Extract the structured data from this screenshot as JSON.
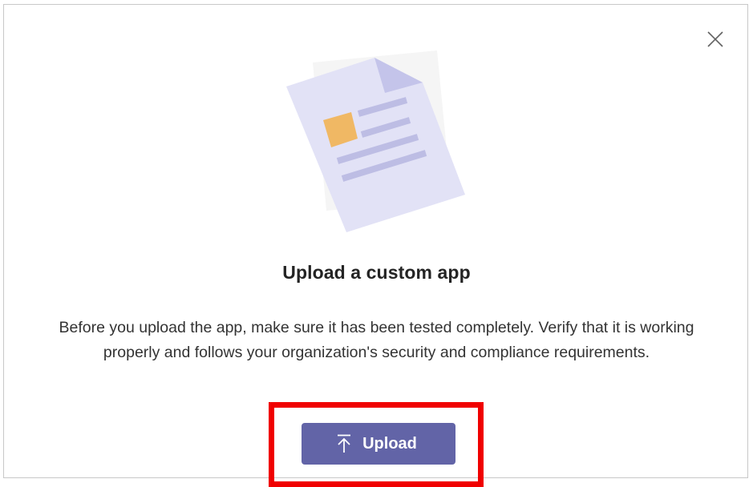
{
  "dialog": {
    "title": "Upload a custom app",
    "description": "Before you upload the app, make sure it has been tested completely. Verify that it is working properly and follows your organization's security and compliance requirements.",
    "upload_button_label": "Upload",
    "close_icon": "close-icon",
    "upload_icon": "upload-arrow-icon",
    "illustration": "document-illustration"
  },
  "colors": {
    "button": "#6264a7",
    "highlight": "#f00000",
    "illustration_page": "#e2e2f6",
    "illustration_fold": "#c4c4ea",
    "illustration_lines": "#bdbde4",
    "illustration_square": "#f0b864"
  }
}
